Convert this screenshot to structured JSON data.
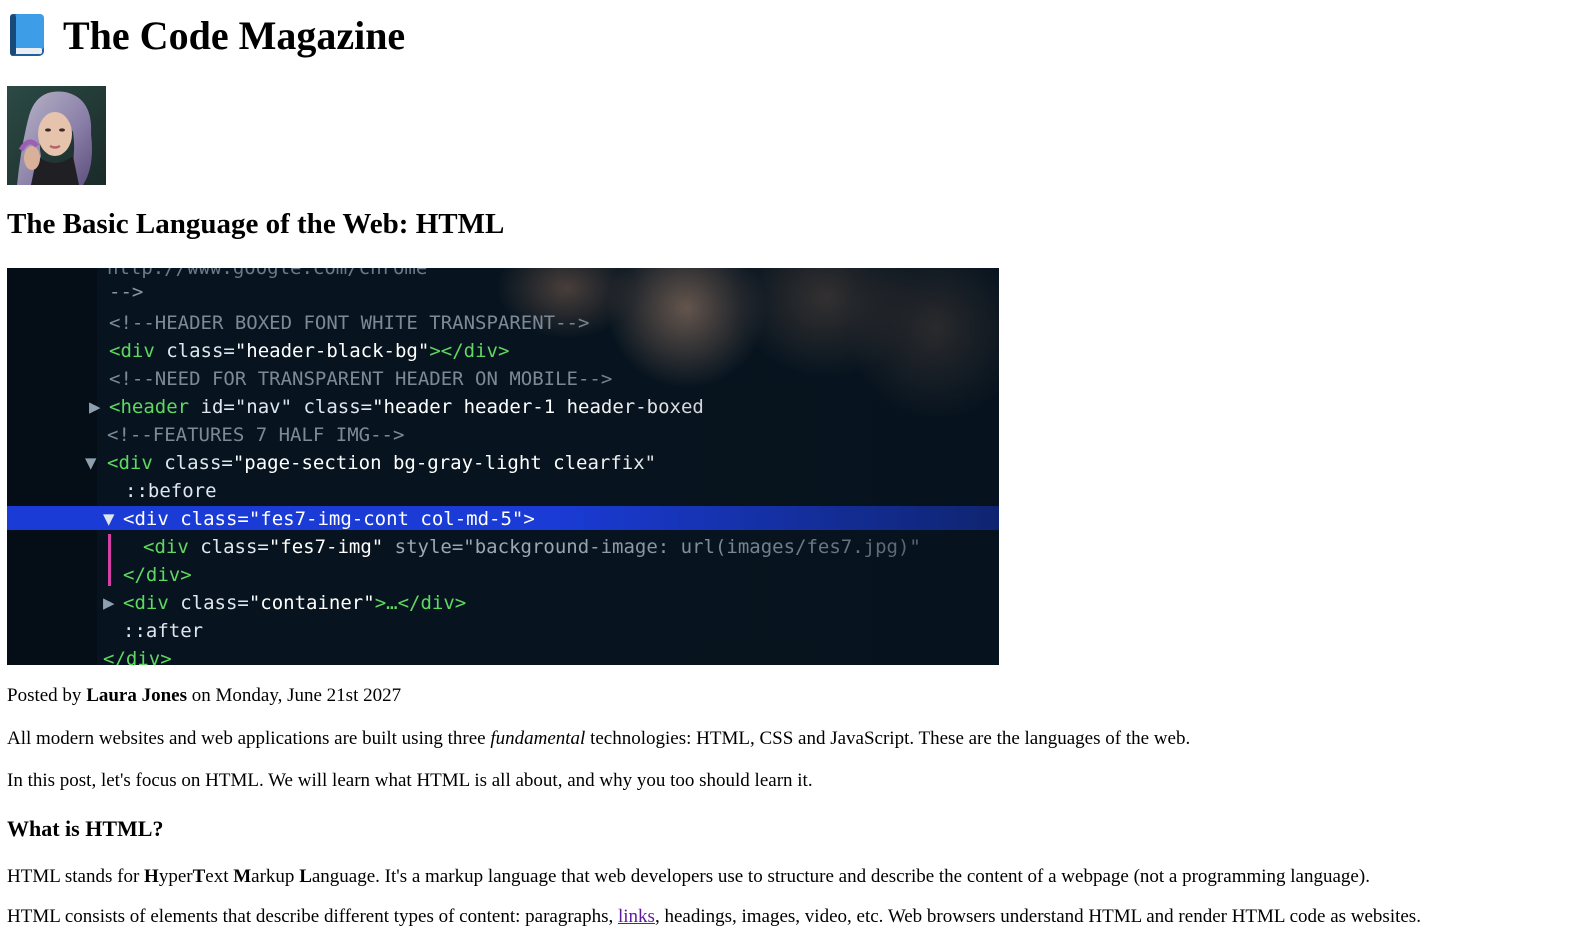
{
  "header": {
    "icon": "book-icon",
    "site_title": "The Code Magazine"
  },
  "author": {
    "avatar_icon": "avatar-photo"
  },
  "post": {
    "title": "The Basic Language of the Web: HTML",
    "hero_image": {
      "icon": "code-screenshot",
      "code_lines": [
        "-->",
        "<!--HEADER BOXED FONT WHITE TRANSPARENT-->",
        "<div class=\"header-black-bg\"></div>",
        "<!--NEED FOR TRANSPARENT HEADER ON MOBILE-->",
        "<header id=\"nav\" class=\"header header-1 header-boxed\">",
        "<!--FEATURES 7 HALF IMG-->",
        "<div class=\"page-section bg-gray-light clearfix\">",
        "::before",
        "<div class=\"fes7-img-cont col-md-5\">",
        "<div class=\"fes7-img\" style=\"background-image: url(images/fes7.jpg)\"></div>",
        "</div>",
        "<div class=\"container\"></div>",
        "::after",
        "</div>"
      ],
      "top_line": "http://www.google.com/chrome"
    },
    "meta": {
      "prefix": "Posted by",
      "author": "Laura Jones",
      "suffix": "on Monday, June 21st 2027"
    },
    "p1": {
      "before": "All modern websites and web applications are built using three",
      "emphasis": "fundamental",
      "after": "technologies: HTML, CSS and JavaScript. These are the languages of the web."
    },
    "p2": "In this post, let's focus on HTML. We will learn what HTML is all about, and why you too should learn it.",
    "h3": "What is HTML?",
    "p3": {
      "before": "HTML stands for",
      "h": "H",
      "yper": "yper",
      "t": "T",
      "ext": "ext",
      "m": "M",
      "arkup": "arkup",
      "l": "L",
      "after": "anguage. It's a markup language that web developers use to structure and describe the content of a webpage (not a programming language)."
    },
    "p4": {
      "before": "HTML consists of elements that describe different types of content: paragraphs,",
      "link": "links",
      "after": ", headings, images, video, etc. Web browsers understand HTML and render HTML code as websites."
    }
  }
}
